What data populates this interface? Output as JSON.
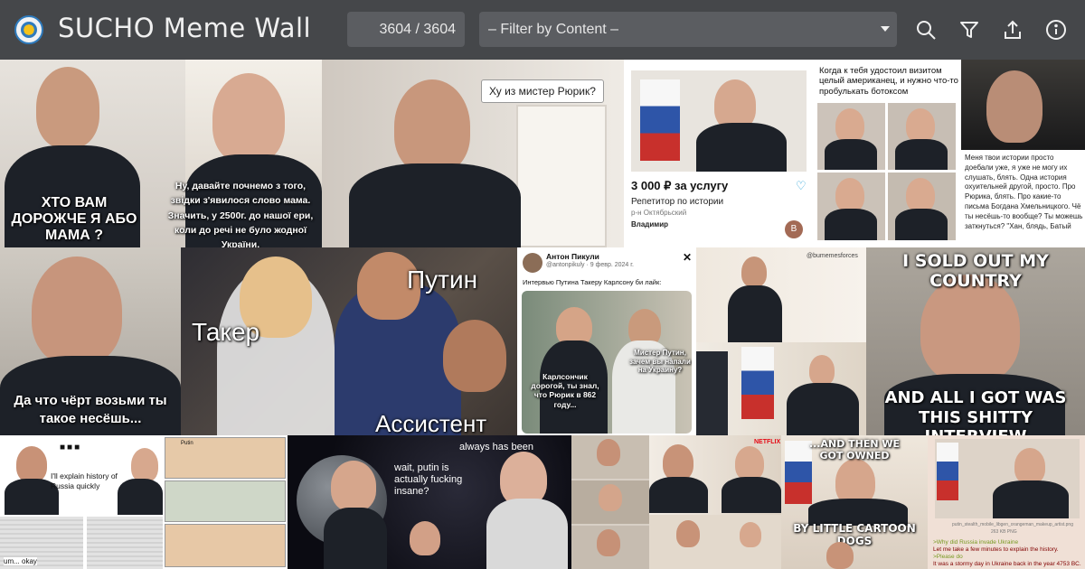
{
  "app": {
    "title": "SUCHO Meme Wall",
    "counter": "3604 / 3604",
    "filter_placeholder": "– Filter by Content –"
  },
  "toolbar": {
    "icons": [
      "search-icon",
      "filter-icon",
      "upload-icon",
      "info-icon"
    ]
  },
  "colors": {
    "topbar": "#45474a",
    "field": "#5b5d61",
    "accent": "#2f7bbd"
  },
  "memes": {
    "m1": {
      "caption_left": "ХТО ВАМ ДОРОЖЧЕ Я АБО МАМА ?",
      "caption_right": "Ну, давайте почнемо з того, звідки з'явилося слово мама. Значить, у 2500г. до нашої ери, коли до речі не було жодної України."
    },
    "m2": {
      "bubble": "Ху из мистер Рюрик?"
    },
    "m3": {
      "price": "3 000 ₽ за услугу",
      "service": "Репетитор по истории",
      "district": "р-н Октябрьский",
      "name": "Владимир",
      "avatar": "В"
    },
    "m4": {
      "caption": "Когда к тебя удостоил визитом целый американец, и нужно что-то пробулькать ботоксом"
    },
    "m5": {
      "caption": "Меня твои истории просто доебали уже, я уже не могу их слушать, блять. Одна история охуительней другой, просто. Про Рюрика, блять. Про какие-то письма Богдана Хмельницкого. Чё ты несёшь-то вообще? Ты можешь заткнуться? \"Хан, блядь, Батый"
    },
    "m6": {
      "caption": "Да что чёрт возьми ты такое несёшь..."
    },
    "m7": {
      "label_top": "Путин",
      "label_left": "Такер",
      "label_bottom": "Ассистент"
    },
    "m8": {
      "author": "Антон Пикули",
      "handle": "@antonpikuly · 9 февр. 2024 г.",
      "text": "Интервью Путина Такеру Карлсону би лайк:",
      "left_caption": "Карлсончик дорогой, ты знал, что Рюрик в 862 году...",
      "right_caption": "Мистер Путин, зачем вы напали на Украину?"
    },
    "m9": {
      "watermark": "@bumemesforces"
    },
    "m10": {
      "top": "I SOLD OUT MY COUNTRY",
      "bottom": "AND ALL I GOT WAS THIS SHITTY INTERVIEW"
    },
    "m11": {
      "dots": "■■■",
      "bubble": "I'll explain history of Russia quickly",
      "bottom": "um... okay"
    },
    "m12": {
      "label": "Putin"
    },
    "m13": {
      "top": "always has been",
      "bubble": "wait, putin is actually fucking insane?"
    },
    "m14": {
      "top": "...AND THEN WE GOT OWNED",
      "bottom": "BY LITTLE CARTOON DOGS"
    },
    "m15": {
      "filename": "putin_stealth_mobile_libgen_orangeman_makeup_artist.png",
      "size": "263 KB PNG",
      "l1": ">Why did Russia invade Ukraine",
      "l2": "Let me take a few minutes to explain the history.",
      "l3": ">Please do",
      "l4": "It was a stormy day in Ukraine back in the year 4753 BC."
    },
    "m16": {
      "logo": "NETFLIX"
    }
  }
}
